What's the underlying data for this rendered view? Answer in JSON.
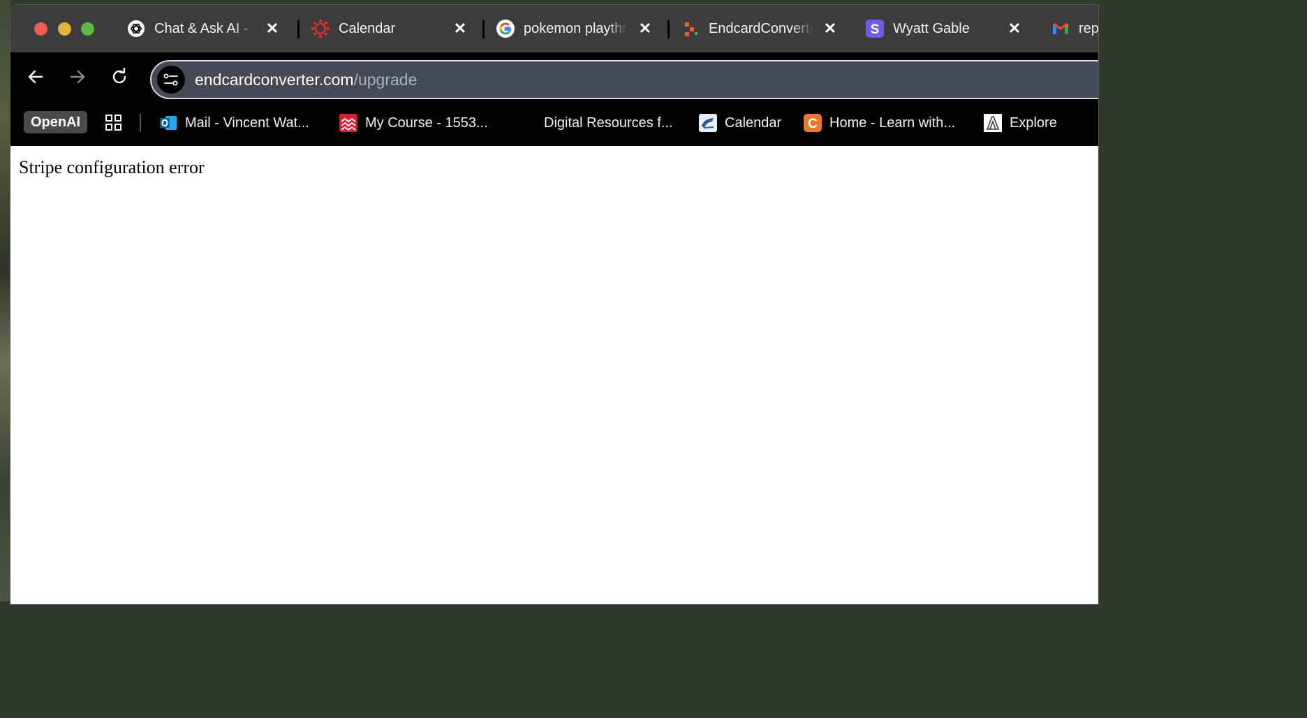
{
  "tabs": [
    {
      "title": "Chat & Ask AI - ",
      "icon": "openai-icon"
    },
    {
      "title": "Calendar",
      "icon": "canvas-icon"
    },
    {
      "title": "pokemon playthrough",
      "icon": "google-icon"
    },
    {
      "title": "EndcardConverter",
      "icon": "endcard-icon"
    },
    {
      "title": "Wyatt Gable",
      "icon": "s-icon"
    },
    {
      "title": "rep",
      "icon": "gmail-icon"
    }
  ],
  "toolbar": {
    "url_domain": "endcardconverter.com",
    "url_path": "/upgrade"
  },
  "bookmarks": {
    "folder": "OpenAI",
    "items": [
      {
        "label": "Mail - Vincent Wat...",
        "icon": "outlook-icon"
      },
      {
        "label": "My Course - 1553...",
        "icon": "course-icon"
      },
      {
        "label": "Digital Resources f...",
        "icon": "none"
      },
      {
        "label": "Calendar",
        "icon": "calendar-icon"
      },
      {
        "label": "Home - Learn with...",
        "icon": "c-icon"
      },
      {
        "label": "Explore",
        "icon": "explore-icon"
      }
    ]
  },
  "page": {
    "message": "Stripe configuration error"
  },
  "colors": {
    "tabstrip": "#3c3c3c",
    "toolbar": "#000000",
    "omnibox": "#454a56"
  }
}
